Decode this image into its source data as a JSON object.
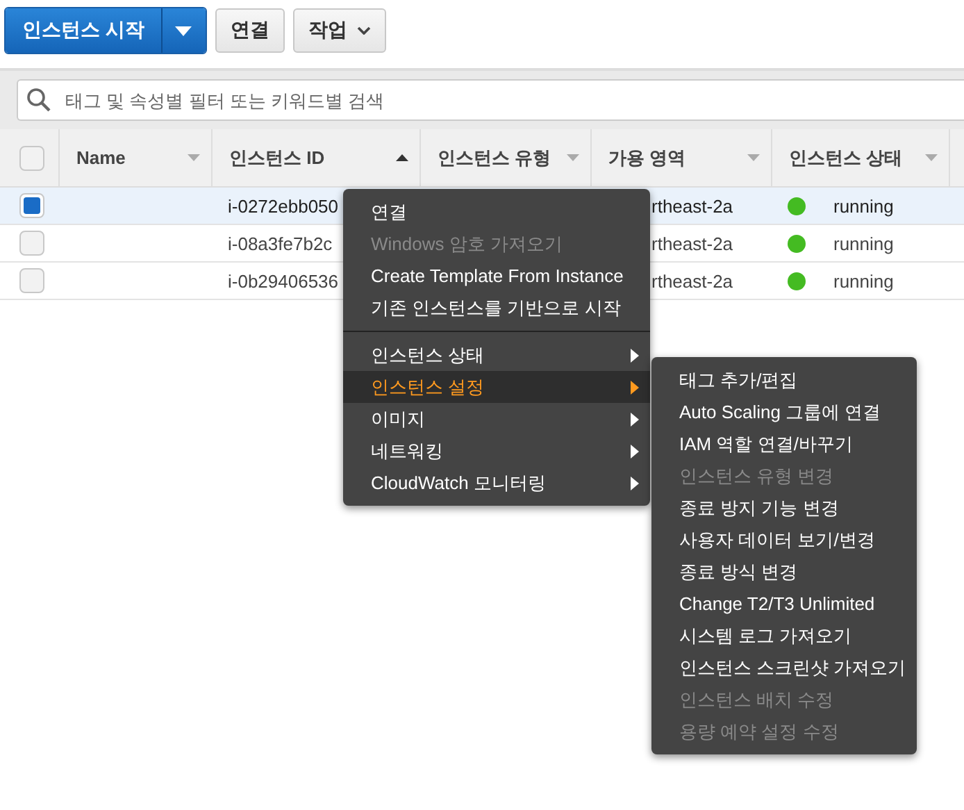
{
  "toolbar": {
    "launch_button": "인스턴스 시작",
    "connect_button": "연결",
    "actions_button": "작업"
  },
  "search": {
    "placeholder": "태그 및 속성별 필터 또는 키워드별 검색"
  },
  "table": {
    "all_checked": false,
    "columns": [
      {
        "label": "Name",
        "sorted": false
      },
      {
        "label": "인스턴스 ID",
        "sorted": true
      },
      {
        "label": "인스턴스 유형",
        "sorted": false
      },
      {
        "label": "가용 영역",
        "sorted": false
      },
      {
        "label": "인스턴스 상태",
        "sorted": false
      }
    ],
    "rows": [
      {
        "selected": true,
        "instance_id": "i-0272ebb050",
        "zone": "rtheast-2a",
        "state": "running",
        "color": "#44bb22"
      },
      {
        "selected": false,
        "instance_id": "i-08a3fe7b2c",
        "zone": "rtheast-2a",
        "state": "running",
        "color": "#44bb22"
      },
      {
        "selected": false,
        "instance_id": "i-0b29406536",
        "zone": "rtheast-2a",
        "state": "running",
        "color": "#44bb22"
      }
    ]
  },
  "context_menu": {
    "items": [
      {
        "kind": "item",
        "label": "연결",
        "disabled": false
      },
      {
        "kind": "item",
        "label": "Windows 암호 가져오기",
        "disabled": true
      },
      {
        "kind": "item",
        "label": "Create Template From Instance",
        "disabled": false
      },
      {
        "kind": "item",
        "label": "기존 인스턴스를 기반으로 시작",
        "disabled": false
      },
      {
        "kind": "separator"
      },
      {
        "kind": "submenu",
        "label": "인스턴스 상태",
        "selected": false
      },
      {
        "kind": "submenu",
        "label": "인스턴스 설정",
        "selected": true
      },
      {
        "kind": "submenu",
        "label": "이미지",
        "selected": false
      },
      {
        "kind": "submenu",
        "label": "네트워킹",
        "selected": false
      },
      {
        "kind": "submenu",
        "label": "CloudWatch 모니터링",
        "selected": false
      }
    ]
  },
  "submenu": {
    "items": [
      {
        "label": "태그 추가/편집",
        "disabled": false
      },
      {
        "label": "Auto Scaling 그룹에 연결",
        "disabled": false
      },
      {
        "label": "IAM 역할 연결/바꾸기",
        "disabled": false
      },
      {
        "label": "인스턴스 유형 변경",
        "disabled": true
      },
      {
        "label": "종료 방지 기능 변경",
        "disabled": false
      },
      {
        "label": "사용자 데이터 보기/변경",
        "disabled": false
      },
      {
        "label": "종료 방식 변경",
        "disabled": false
      },
      {
        "label": "Change T2/T3 Unlimited",
        "disabled": false
      },
      {
        "label": "시스템 로그 가져오기",
        "disabled": false
      },
      {
        "label": "인스턴스 스크린샷 가져오기",
        "disabled": false
      },
      {
        "label": "인스턴스 배치 수정",
        "disabled": true
      },
      {
        "label": "용량 예약 설정 수정",
        "disabled": true
      }
    ]
  }
}
